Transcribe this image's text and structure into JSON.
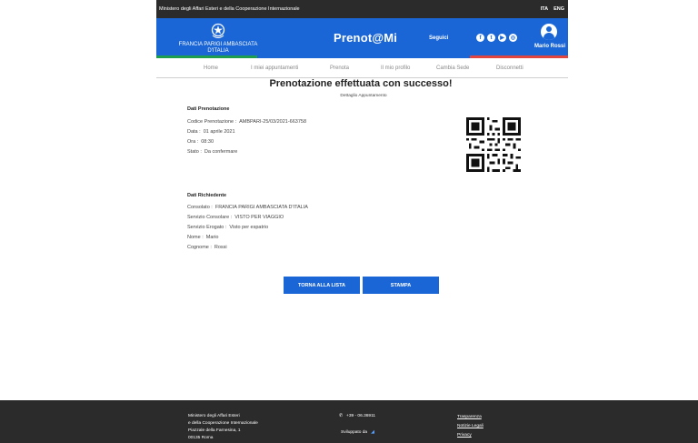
{
  "topbar": {
    "ministry": "Ministero degli Affari Esteri e della Cooperazione Internazionale",
    "lang_ita": "ITA",
    "lang_eng": "ENG"
  },
  "header": {
    "embassy": "FRANCIA PARIGI AMBASCIATA D'ITALIA",
    "brand": "Prenot@Mi",
    "follow_label": "Seguici",
    "social_icons": [
      "facebook-icon",
      "twitter-icon",
      "youtube-icon",
      "instagram-icon"
    ],
    "user": "Mario Rossi",
    "colors": {
      "primary": "#1a66d6",
      "green": "#1f9d4f",
      "red": "#e0453f"
    }
  },
  "nav": [
    "Home",
    "I miei appuntamenti",
    "Prenota",
    "Il mio profilo",
    "Cambia Sede",
    "Disconnetti"
  ],
  "page": {
    "title": "Prenotazione effettuata con successo!",
    "subtitle": "Dettaglio Appuntamento"
  },
  "booking": {
    "section_title": "Dati Prenotazione",
    "rows": [
      {
        "label": "Codice Prenotazione :",
        "value": "AMBPARI-25/03/2021-663758"
      },
      {
        "label": "Data :",
        "value": "01 aprile 2021"
      },
      {
        "label": "Ora :",
        "value": "08:30"
      },
      {
        "label": "Stato :",
        "value": "Da confermare"
      }
    ]
  },
  "applicant": {
    "section_title": "Dati Richiedente",
    "rows": [
      {
        "label": "Consolato :",
        "value": "FRANCIA PARIGI AMBASCIATA D'ITALIA"
      },
      {
        "label": "Servizio Consolare :",
        "value": "VISTO PER VIAGGIO"
      },
      {
        "label": "Servizio Erogato :",
        "value": "Visto per espatrio"
      },
      {
        "label": "Nome :",
        "value": "Mario"
      },
      {
        "label": "Cognome :",
        "value": "Rossi"
      }
    ]
  },
  "buttons": {
    "back": "TORNA ALLA LISTA",
    "print": "STAMPA"
  },
  "footer": {
    "address": [
      "Ministero degli Affari Esteri",
      "e della Cooperazione Internazionale",
      "Piazzale della Farnesina, 1",
      "00135 Roma"
    ],
    "phone": "+39 - 06.36911",
    "developed_by": "Sviluppato da",
    "links": [
      "Trasparenza",
      "Notizie Legali",
      "Privacy"
    ]
  }
}
